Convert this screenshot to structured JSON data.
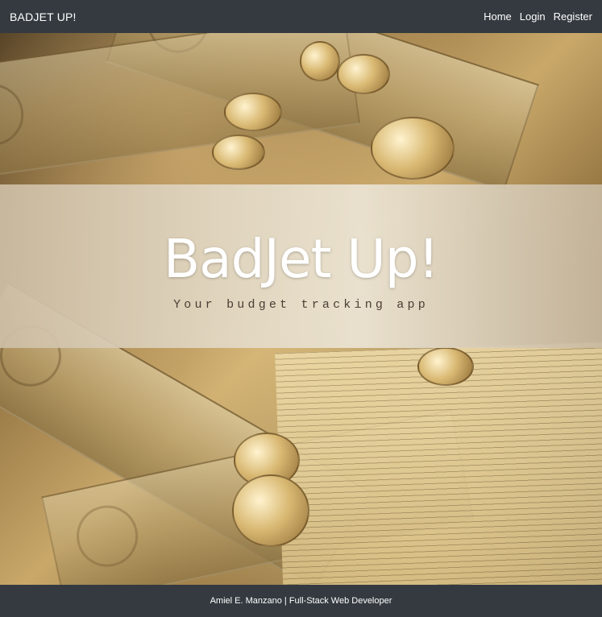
{
  "navbar": {
    "brand": "BADJET UP!",
    "links": [
      {
        "label": "Home"
      },
      {
        "label": "Login"
      },
      {
        "label": "Register"
      }
    ]
  },
  "hero": {
    "title": "BadJet Up!",
    "subtitle": "Your budget tracking app"
  },
  "footer": {
    "text": "Amiel E. Manzano | Full-Stack Web Developer"
  }
}
